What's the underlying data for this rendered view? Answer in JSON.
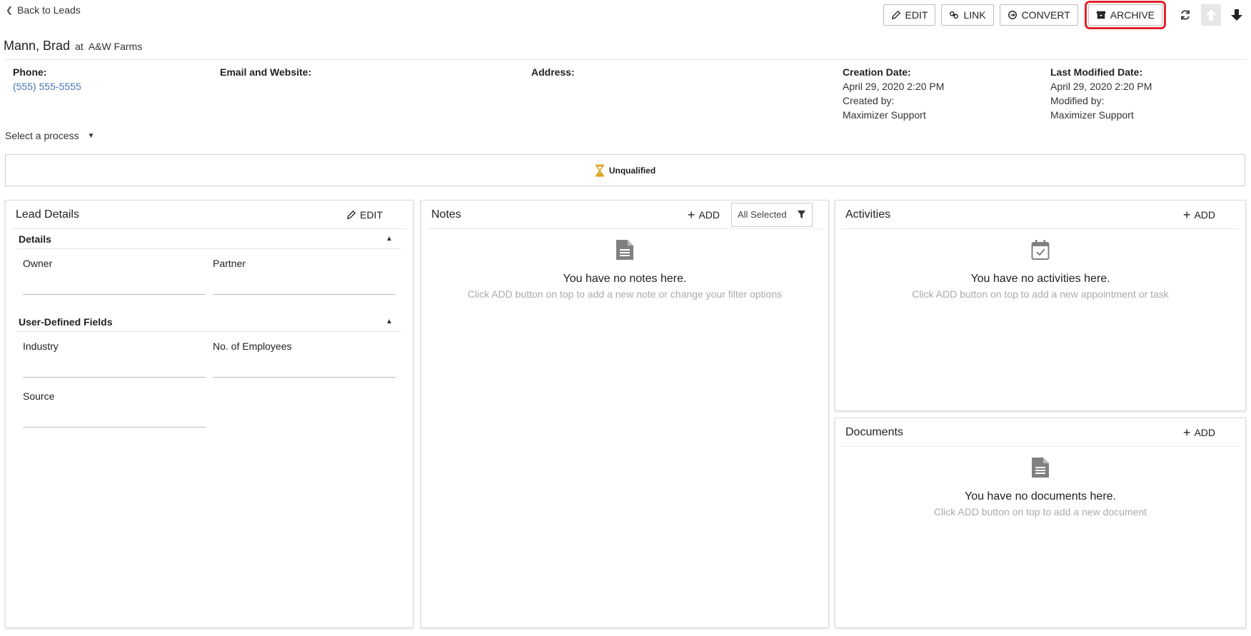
{
  "nav": {
    "back_label": "Back to Leads"
  },
  "toolbar": {
    "edit_label": "EDIT",
    "link_label": "LINK",
    "convert_label": "CONVERT",
    "archive_label": "ARCHIVE"
  },
  "lead": {
    "name": "Mann, Brad",
    "at_label": "at",
    "company": "A&W Farms"
  },
  "info": {
    "phone_label": "Phone:",
    "phone_value": "(555) 555-5555",
    "email_label": "Email and Website:",
    "address_label": "Address:",
    "creation_label": "Creation Date:",
    "creation_value": "April 29, 2020 2:20 PM",
    "created_by_label": "Created by:",
    "created_by_value": "Maximizer Support",
    "modified_label": "Last Modified Date:",
    "modified_value": "April 29, 2020 2:20 PM",
    "modified_by_label": "Modified by:",
    "modified_by_value": "Maximizer Support"
  },
  "process": {
    "label": "Select a process"
  },
  "stage": {
    "label": "Unqualified",
    "icon": "hourglass-icon",
    "icon_color": "#d9a520"
  },
  "lead_details": {
    "title": "Lead Details",
    "edit_label": "EDIT",
    "sections": [
      {
        "title": "Details",
        "fields": [
          "Owner",
          "Partner"
        ]
      },
      {
        "title": "User-Defined Fields",
        "fields": [
          "Industry",
          "No. of Employees",
          "Source"
        ]
      }
    ]
  },
  "notes": {
    "title": "Notes",
    "add_label": "ADD",
    "filter_label": "All Selected",
    "empty_main": "You have no notes here.",
    "empty_sub": "Click ADD button on top to add a new note or change your filter options"
  },
  "activities": {
    "title": "Activities",
    "add_label": "ADD",
    "empty_main": "You have no activities here.",
    "empty_sub": "Click ADD button on top to add a new appointment or task"
  },
  "documents": {
    "title": "Documents",
    "add_label": "ADD",
    "empty_main": "You have no documents here.",
    "empty_sub": "Click ADD button on top to add a new document"
  },
  "colors": {
    "link": "#4a78b0",
    "highlight": "#e2232a",
    "muted": "#aaaaaa"
  }
}
